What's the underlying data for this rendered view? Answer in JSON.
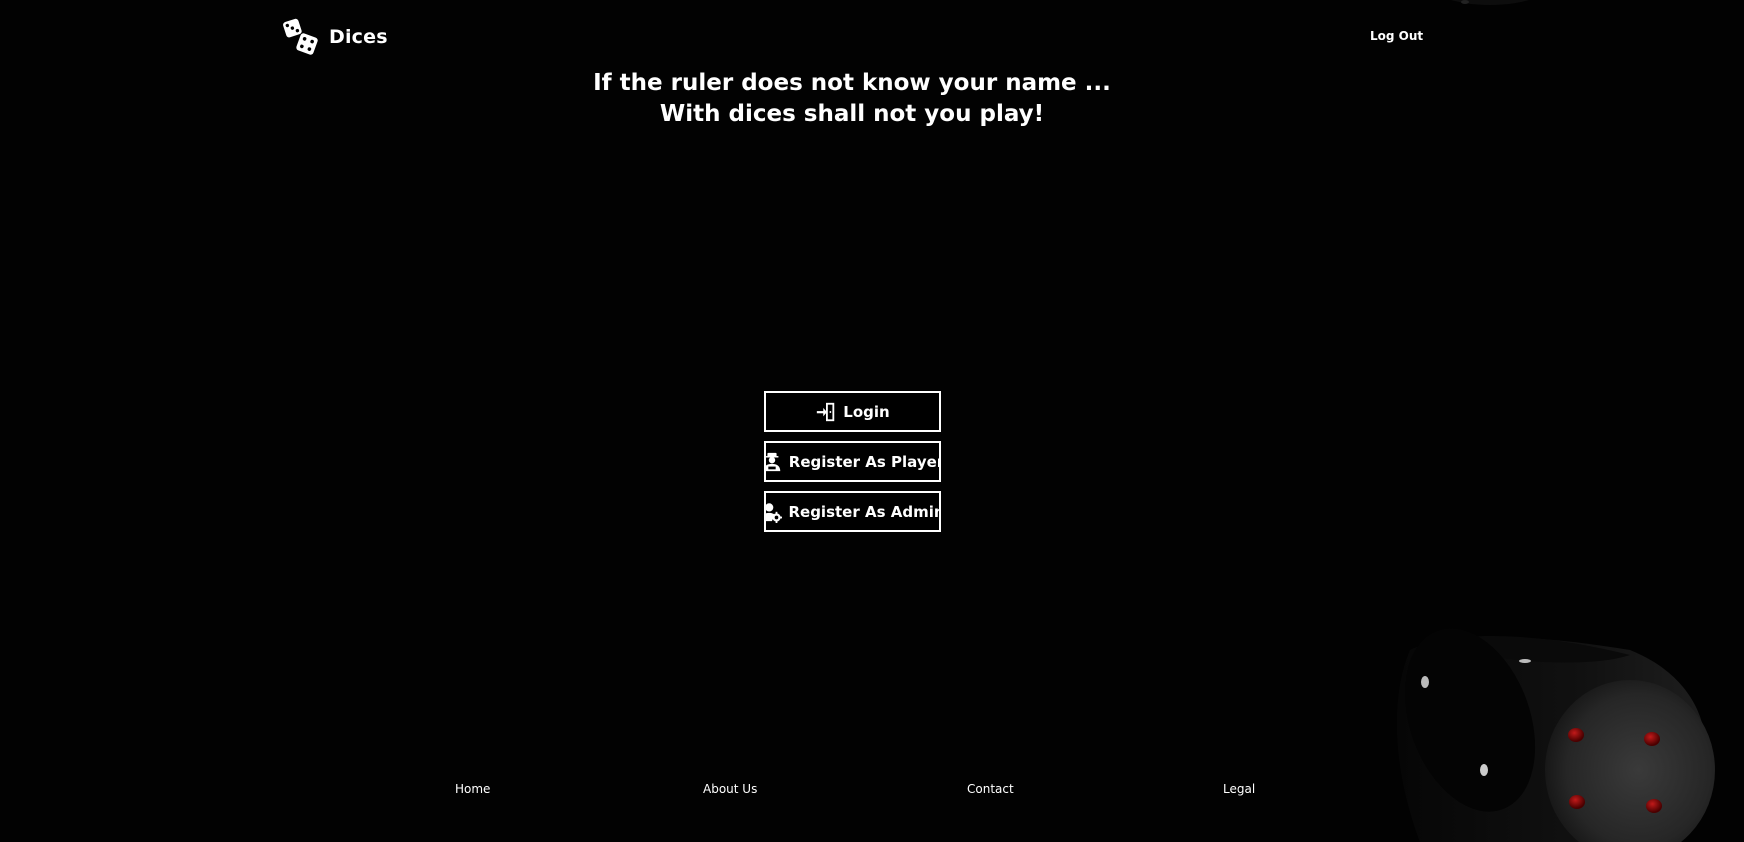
{
  "header": {
    "brand_name": "Dices",
    "logout_label": "Log Out",
    "brand_icon": "dice-icon"
  },
  "headline": {
    "line1": "If the ruler does not know your name ...",
    "line2": "With dices shall not you play!"
  },
  "actions": {
    "login_label": "Login",
    "login_icon": "login-door-icon",
    "register_player_label": "Register As Player",
    "register_player_icon": "player-icon",
    "register_admin_label": "Register As Admin",
    "register_admin_icon": "admin-gear-icon"
  },
  "footer": {
    "links": [
      "Home",
      "About Us",
      "Contact",
      "Legal"
    ]
  },
  "colors": {
    "background": "#020202",
    "text": "#ffffff",
    "button_border": "#ffffff",
    "die_pip": "#8b0000"
  }
}
